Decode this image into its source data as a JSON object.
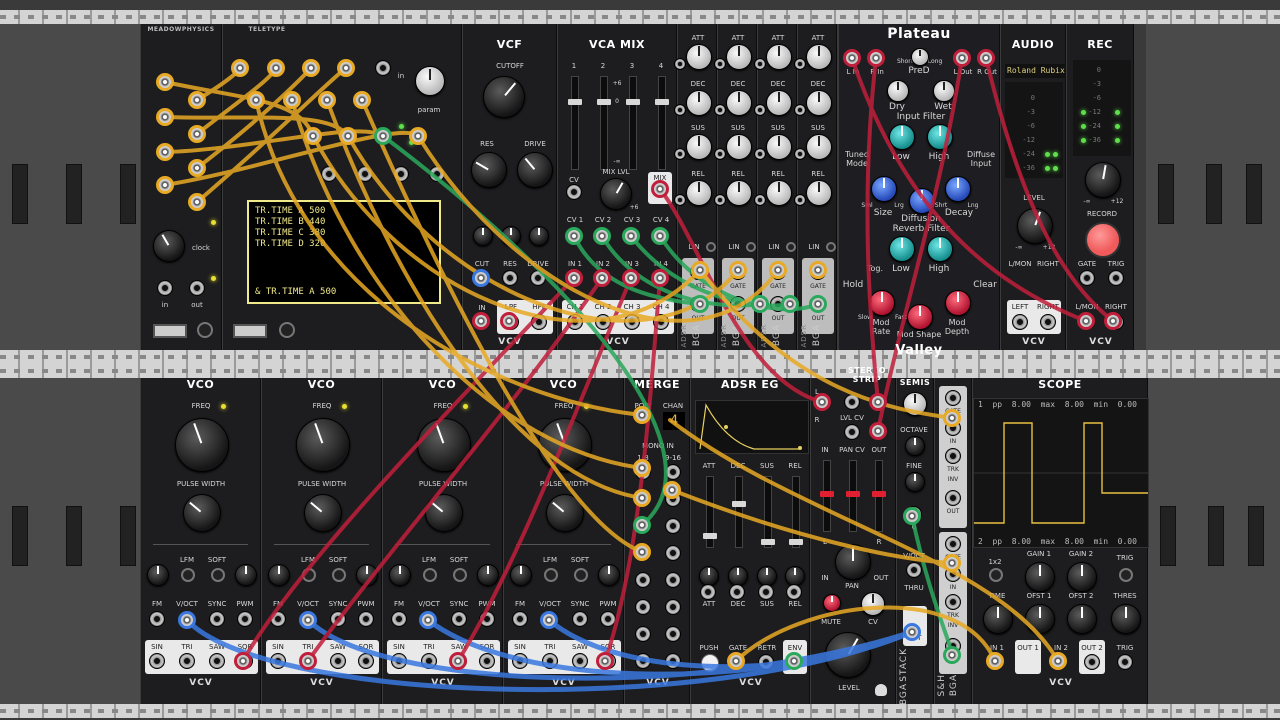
{
  "rack": {
    "rails": 4
  },
  "modules": {
    "meadowphysics": {
      "title": "MEADOWPHYSICS",
      "clock_label": "clock",
      "in_label": "in",
      "out_label": "out"
    },
    "teletype": {
      "title": "TELETYPE",
      "in_label": "in",
      "param_label": "param",
      "screen_lines": [
        "TR.TIME A 500",
        "TR.TIME B 440",
        "TR.TIME C 380",
        "TR.TIME D 320"
      ],
      "prompt": "& TR.TIME A 500"
    },
    "vcf": {
      "title": "VCF",
      "cutoff": "CUTOFF",
      "res": "RES",
      "drive": "DRIVE",
      "jack_cut": "CUT",
      "jack_res": "RES",
      "jack_drive": "DRIVE",
      "jack_in": "IN",
      "out_lpf": "LPF",
      "out_hpf": "HPF",
      "brand": "VCV"
    },
    "vcamix": {
      "title": "VCA MIX",
      "ch_nums": [
        "1",
        "2",
        "3",
        "4"
      ],
      "mix_lvl": "MIX LVL",
      "cv": "CV",
      "mix": "MIX",
      "cv_labels": [
        "CV 1",
        "CV 2",
        "CV 3",
        "CV 4"
      ],
      "in_labels": [
        "IN 1",
        "IN 2",
        "IN 3",
        "IN 4"
      ],
      "ch_labels": [
        "CH 1",
        "CH 2",
        "CH 3",
        "CH 4"
      ],
      "brand": "VCV",
      "scale_top": "+6",
      "scale_mid": "0",
      "scale_bot": "-∞",
      "knob_tick": "+6"
    },
    "adsr_small": {
      "labels": [
        "ATT",
        "DEC",
        "SUS",
        "REL"
      ],
      "lin": "LIN",
      "gate": "GATE",
      "out": "OUT",
      "side": "ADSR",
      "brand": "BGA",
      "count": 4
    },
    "plateau": {
      "title": "Plateau",
      "footer": "Valley",
      "l_in": "L In",
      "r_in": "R In",
      "l_out": "L Out",
      "r_out": "R Out",
      "pred": "PreD",
      "short": "Short",
      "long": "Long",
      "dry": "Dry",
      "wet": "Wet",
      "input_filter": "Input Filter",
      "low": "Low",
      "high": "High",
      "tuned_mode": "Tuned Mode",
      "diffuse_input": "Diffuse Input",
      "sml": "Sml",
      "lrg": "Lrg",
      "shrt": "Shrt",
      "lng": "Lng",
      "size": "Size",
      "diffusion": "Diffusion",
      "decay": "Decay",
      "reverb_filter": "Reverb Filter",
      "low2": "Low",
      "high2": "High",
      "tog": "Tog.",
      "hold": "Hold",
      "clear": "Clear",
      "slow": "Slow",
      "fast": "Fast",
      "mod_rate": "Mod Rate",
      "mod_shape": "Mod Shape",
      "mod_depth": "Mod Depth"
    },
    "audio": {
      "title": "AUDIO",
      "device": "Roland Rubix",
      "level": "LEVEL",
      "l_mon": "L/MON",
      "right": "RIGHT",
      "left": "LEFT",
      "right2": "RIGHT",
      "brand": "VCV",
      "meter": [
        "0",
        "-3",
        "-6",
        "-12",
        "-24",
        "-36"
      ],
      "knob_min": "-∞",
      "knob_max": "+12"
    },
    "rec": {
      "title": "REC",
      "record": "RECORD",
      "gate": "GATE",
      "trig": "TRIG",
      "l_mon": "L/MON",
      "right": "RIGHT",
      "brand": "VCV",
      "meter": [
        "0",
        "-3",
        "-6",
        "-12",
        "-24",
        "-36"
      ],
      "knob_min": "-∞",
      "knob_max": "+12"
    },
    "vcos": [
      {
        "title": "VCO",
        "freq": "FREQ",
        "pw": "PULSE WIDTH",
        "lfm": "LFM",
        "soft": "SOFT",
        "jacks": [
          "FM",
          "V/OCT",
          "SYNC",
          "PWM"
        ],
        "outs": [
          "SIN",
          "TRI",
          "SAW",
          "SQR"
        ],
        "brand": "VCV"
      },
      {
        "title": "VCO",
        "freq": "FREQ",
        "pw": "PULSE WIDTH",
        "lfm": "LFM",
        "soft": "SOFT",
        "jacks": [
          "FM",
          "V/OCT",
          "SYNC",
          "PWM"
        ],
        "outs": [
          "SIN",
          "TRI",
          "SAW",
          "SQR"
        ],
        "brand": "VCV"
      },
      {
        "title": "VCO",
        "freq": "FREQ",
        "pw": "PULSE WIDTH",
        "lfm": "LFM",
        "soft": "SOFT",
        "jacks": [
          "FM",
          "V/OCT",
          "SYNC",
          "PWM"
        ],
        "outs": [
          "SIN",
          "TRI",
          "SAW",
          "SQR"
        ],
        "brand": "VCV"
      },
      {
        "title": "VCO",
        "freq": "FREQ",
        "pw": "PULSE WIDTH",
        "lfm": "LFM",
        "soft": "SOFT",
        "jacks": [
          "FM",
          "V/OCT",
          "SYNC",
          "PWM"
        ],
        "outs": [
          "SIN",
          "TRI",
          "SAW",
          "SQR"
        ],
        "brand": "VCV"
      }
    ],
    "merge": {
      "title": "MERGE",
      "poly": "POLY",
      "chan": "CHAN",
      "chan_value": "4",
      "mono_in": "MONO IN",
      "r1": "1-8",
      "r2": "9-16",
      "brand": "VCV"
    },
    "adsreg": {
      "title": "ADSR EG",
      "labels": [
        "ATT",
        "DEC",
        "SUS",
        "REL"
      ],
      "push": "PUSH",
      "gate": "GATE",
      "retr": "RETR",
      "env": "ENV",
      "brand": "VCV"
    },
    "stereostrip": {
      "title": "STEREO STRIP",
      "l": "L",
      "r": "R",
      "lvl_cv": "LVL CV",
      "in": "IN",
      "pan_cv": "PAN CV",
      "out": "OUT",
      "pan": "PAN",
      "mute": "MUTE",
      "cv": "CV",
      "level": "LEVEL",
      "l2": "L",
      "r2": "R",
      "in2": "IN",
      "out2": "OUT"
    },
    "semis": {
      "title": "SEMIS",
      "octave": "OCTAVE",
      "fine": "FINE",
      "thru": "THRU",
      "v_oct": "V/OCT",
      "out": "OUT",
      "side": "STACK",
      "brand": "BGA",
      "quant": "Q"
    },
    "sh": {
      "gate": "GATE",
      "in": "IN",
      "trk": "TRK",
      "inv": "INV",
      "out": "OUT",
      "side": "S&H",
      "brand": "BGA"
    },
    "scope": {
      "title": "SCOPE",
      "ch1": "1  pp  8.00  max  8.00  min  0.00",
      "ch2": "2  pp  8.00  max  8.00  min  0.00",
      "x1x2": "1x2",
      "gain1": "GAIN 1",
      "gain2": "GAIN 2",
      "trig": "TRIG",
      "time": "TIME",
      "ofst1": "OFST 1",
      "ofst2": "OFST 2",
      "thres": "THRES",
      "in1": "IN 1",
      "out1": "OUT 1",
      "in2": "IN 2",
      "out2": "OUT 2",
      "trig2": "TRIG",
      "brand": "VCV"
    }
  },
  "colors": {
    "yellow": "#e8a924",
    "red": "#c01f3b",
    "green": "#2aa85b",
    "blue": "#3a78e0",
    "teal": "#2ec4c4"
  }
}
